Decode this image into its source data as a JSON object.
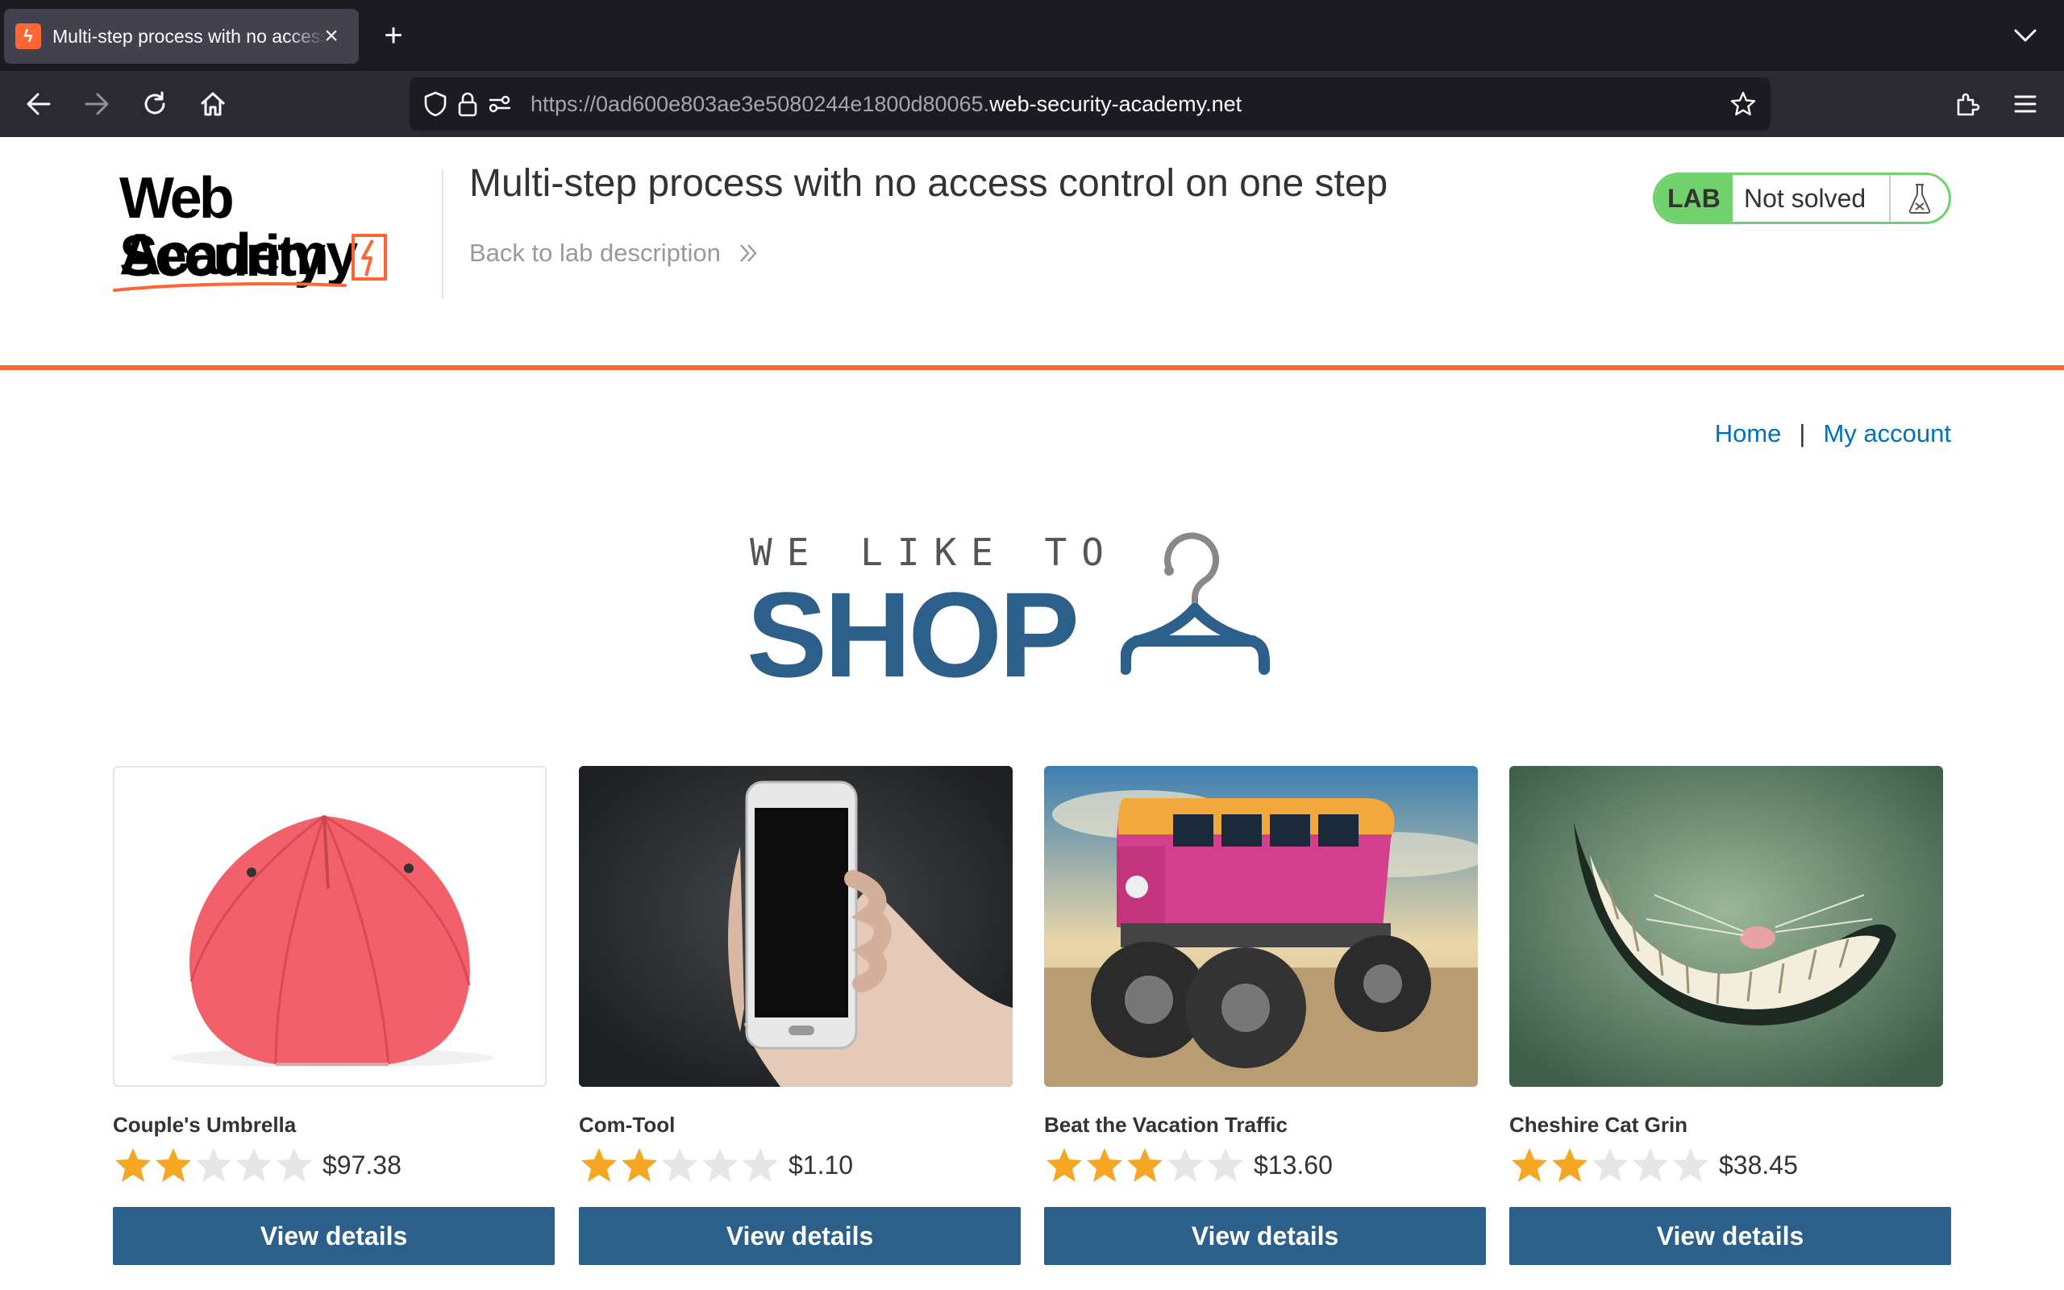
{
  "browser": {
    "tab_title": "Multi-step process with no access control on one step",
    "url_prefix": "https://0ad600e803ae3e5080244e1800d80065.",
    "url_host": "web-security-academy.net"
  },
  "lab_header": {
    "logo_line1": "Web Security",
    "logo_line2": "Academy",
    "title": "Multi-step process with no access control on one step",
    "back_link": "Back to lab description",
    "status_badge": "LAB",
    "status_text": "Not solved",
    "status_color": "#70d16d",
    "accent_color": "#ff6633"
  },
  "nav": {
    "home": "Home",
    "separator": "|",
    "my_account": "My account"
  },
  "banner": {
    "line1": "WE LIKE TO",
    "line2": "SHOP",
    "icon": "hanger-icon"
  },
  "products": [
    {
      "name": "Couple's Umbrella",
      "rating": 2,
      "price": "$97.38",
      "button": "View details",
      "image": "red-umbrella"
    },
    {
      "name": "Com-Tool",
      "rating": 2,
      "price": "$1.10",
      "button": "View details",
      "image": "hand-holding-phone"
    },
    {
      "name": "Beat the Vacation Traffic",
      "rating": 3,
      "price": "$13.60",
      "button": "View details",
      "image": "monster-truck-van"
    },
    {
      "name": "Cheshire Cat Grin",
      "rating": 2,
      "price": "$38.45",
      "button": "View details",
      "image": "cheshire-grin"
    }
  ]
}
